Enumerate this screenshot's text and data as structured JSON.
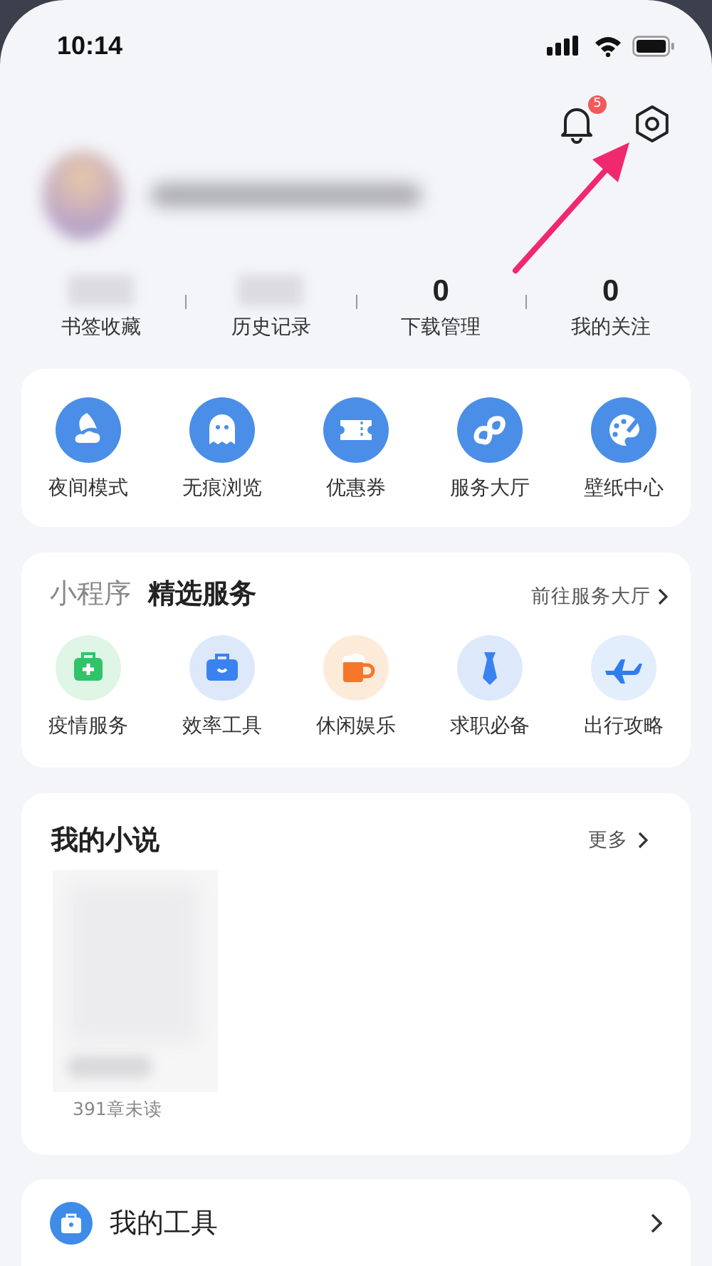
{
  "status_bar": {
    "time": "10:14"
  },
  "notifications": {
    "badge": "5"
  },
  "stats": [
    {
      "label": "书签收藏"
    },
    {
      "label": "历史记录"
    },
    {
      "value": "0",
      "label": "下载管理"
    },
    {
      "value": "0",
      "label": "我的关注"
    }
  ],
  "quick_actions": [
    {
      "kind": "night",
      "label": "夜间模式"
    },
    {
      "kind": "ghost",
      "label": "无痕浏览"
    },
    {
      "kind": "ticket",
      "label": "优惠券"
    },
    {
      "kind": "link",
      "label": "服务大厅"
    },
    {
      "kind": "palette",
      "label": "壁纸中心"
    }
  ],
  "services": {
    "tab_muted": "小程序",
    "title": "精选服务",
    "link": "前往服务大厅",
    "items": [
      {
        "kind": "medkit",
        "label": "疫情服务",
        "color": "#2fc46a"
      },
      {
        "kind": "briefcase",
        "label": "效率工具",
        "color": "#3a82f0"
      },
      {
        "kind": "mug",
        "label": "休闲娱乐",
        "color": "#f5772a"
      },
      {
        "kind": "tie",
        "label": "求职必备",
        "color": "#3a82f0"
      },
      {
        "kind": "plane",
        "label": "出行攻略",
        "color": "#2f7ef0"
      }
    ]
  },
  "novels": {
    "title": "我的小说",
    "more": "更多",
    "books": [
      {
        "kind": "picture",
        "progress": "391章未读"
      }
    ]
  },
  "tools": {
    "title": "我的工具"
  }
}
